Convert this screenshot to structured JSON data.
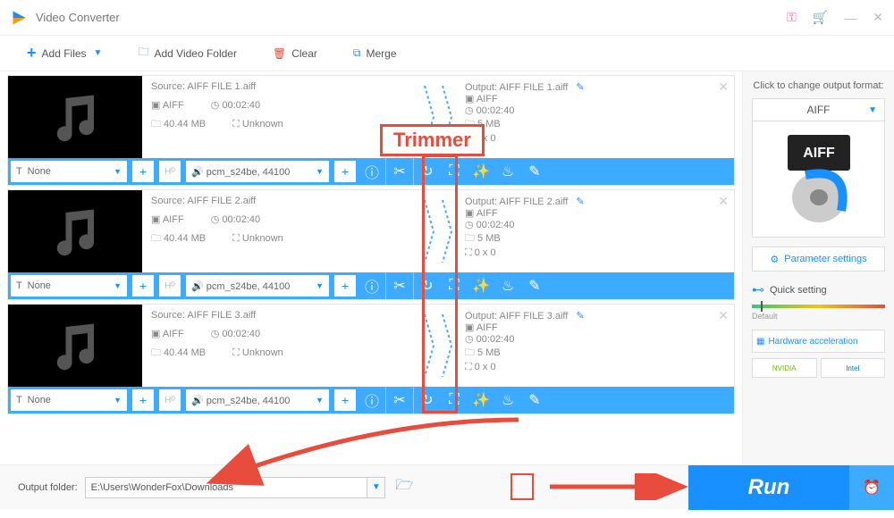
{
  "app": {
    "title": "Video Converter"
  },
  "toolbar": {
    "add_files": "Add Files",
    "add_folder": "Add Video Folder",
    "clear": "Clear",
    "merge": "Merge"
  },
  "files": [
    {
      "source_label": "Source: AIFF FILE 1.aiff",
      "format": "AIFF",
      "duration": "00:02:40",
      "size": "40.44 MB",
      "resolution": "Unknown",
      "output_label": "Output: AIFF FILE 1.aiff",
      "out_format": "AIFF",
      "out_duration": "00:02:40",
      "out_size": "5 MB",
      "out_res": "0 x 0",
      "subtitle": "None",
      "audio": "pcm_s24be, 44100"
    },
    {
      "source_label": "Source: AIFF FILE 2.aiff",
      "format": "AIFF",
      "duration": "00:02:40",
      "size": "40.44 MB",
      "resolution": "Unknown",
      "output_label": "Output: AIFF FILE 2.aiff",
      "out_format": "AIFF",
      "out_duration": "00:02:40",
      "out_size": "5 MB",
      "out_res": "0 x 0",
      "subtitle": "None",
      "audio": "pcm_s24be, 44100"
    },
    {
      "source_label": "Source: AIFF FILE 3.aiff",
      "format": "AIFF",
      "duration": "00:02:40",
      "size": "40.44 MB",
      "resolution": "Unknown",
      "output_label": "Output: AIFF FILE 3.aiff",
      "out_format": "AIFF",
      "out_duration": "00:02:40",
      "out_size": "5 MB",
      "out_res": "0 x 0",
      "subtitle": "None",
      "audio": "pcm_s24be, 44100"
    }
  ],
  "sidebar": {
    "format_label": "Click to change output format:",
    "format_name": "AIFF",
    "param_btn": "Parameter settings",
    "quick_label": "Quick setting",
    "default_label": "Default",
    "hw_label": "Hardware acceleration",
    "nvidia": "NVIDIA",
    "intel": "Intel"
  },
  "footer": {
    "output_label": "Output folder:",
    "path": "E:\\Users\\WonderFox\\Downloads",
    "run": "Run"
  },
  "annotations": {
    "trimmer_label": "Trimmer"
  }
}
